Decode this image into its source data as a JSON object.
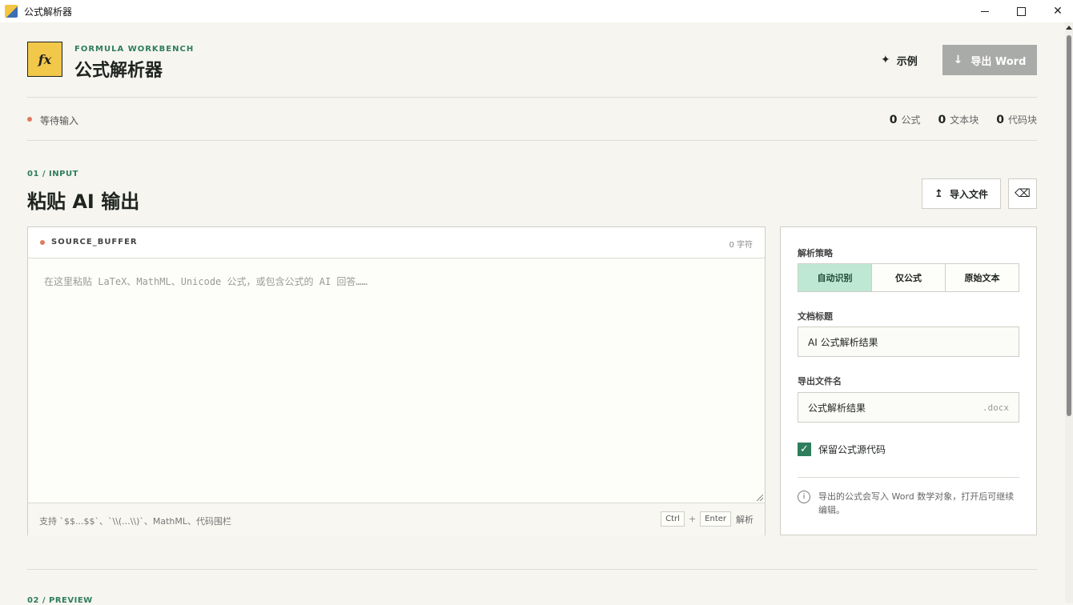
{
  "window": {
    "title": "公式解析器"
  },
  "header": {
    "kicker": "FORMULA WORKBENCH",
    "title": "公式解析器",
    "logo_text": "fx",
    "example_label": "示例",
    "export_label": "导出 Word"
  },
  "status": {
    "text": "等待输入",
    "counts": [
      {
        "value": "0",
        "label": "公式"
      },
      {
        "value": "0",
        "label": "文本块"
      },
      {
        "value": "0",
        "label": "代码块"
      }
    ]
  },
  "input_section": {
    "kicker": "01 / INPUT",
    "title": "粘贴 AI 输出",
    "import_label": "导入文件",
    "clear_glyph": "⌫"
  },
  "editor": {
    "label": "SOURCE_BUFFER",
    "char_count": "0 字符",
    "placeholder": "在这里粘贴 LaTeX、MathML、Unicode 公式，或包含公式的 AI 回答……",
    "hint": "支持 `$$...$$`、`\\\\(...\\\\)`、MathML、代码围栏",
    "key1": "Ctrl",
    "key_plus": "+",
    "key2": "Enter",
    "key_action": "解析"
  },
  "options": {
    "strategy_label": "解析策略",
    "strategies": [
      "自动识别",
      "仅公式",
      "原始文本"
    ],
    "active_strategy": 0,
    "doc_title_label": "文档标题",
    "doc_title_value": "AI 公式解析结果",
    "filename_label": "导出文件名",
    "filename_value": "公式解析结果",
    "filename_ext": ".docx",
    "keep_source_label": "保留公式源代码",
    "keep_source_checked": true,
    "info_text": "导出的公式会写入 Word 数学对象，打开后可继续编辑。"
  },
  "preview_section": {
    "kicker": "02 / PREVIEW"
  },
  "colors": {
    "accent": "#2e7d5b",
    "logo": "#f2c84b",
    "status_dot": "#e07a5f",
    "active_segment": "#bfe8d4"
  }
}
